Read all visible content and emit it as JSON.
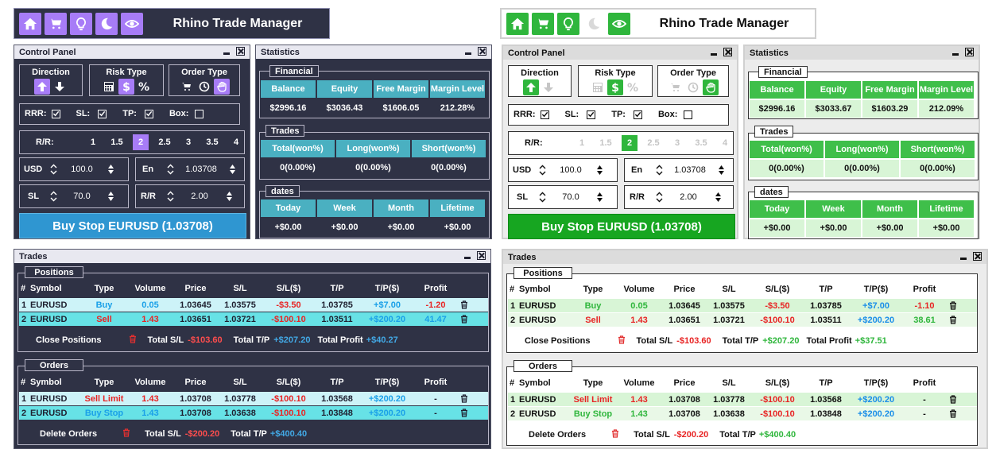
{
  "app_title": "Rhino Trade Manager",
  "window_titles": {
    "control_panel": "Control Panel",
    "statistics": "Statistics",
    "trades": "Trades"
  },
  "control": {
    "direction_label": "Direction",
    "risk_type_label": "Risk Type",
    "order_type_label": "Order Type",
    "rrr_label": "RRR:",
    "sl_label": "SL:",
    "tp_label": "TP:",
    "box_label": "Box:",
    "rr_label": "R/R:",
    "rr_options": [
      "1",
      "1.5",
      "2",
      "2.5",
      "3",
      "3.5",
      "4"
    ],
    "rr_selected": "2",
    "usd_label": "USD",
    "usd_value": "100.0",
    "en_label": "En",
    "en_value": "1.03708",
    "sl_field_label": "SL",
    "sl_value": "70.0",
    "rr_field_label": "R/R",
    "rr_value": "2.00",
    "buy_button": "Buy Stop EURUSD (1.03708)"
  },
  "stats": {
    "financial_title": "Financial",
    "financial_headers": [
      "Balance",
      "Equity",
      "Free Margin",
      "Margin Level"
    ],
    "trades_title": "Trades",
    "trades_headers": [
      "Total(won%)",
      "Long(won%)",
      "Short(won%)"
    ],
    "trades_values": [
      "0(0.00%)",
      "0(0.00%)",
      "0(0.00%)"
    ],
    "dates_title": "dates",
    "dates_headers": [
      "Today",
      "Week",
      "Month",
      "Lifetime"
    ],
    "dates_values": [
      "+$0.00",
      "+$0.00",
      "+$0.00",
      "+$0.00"
    ]
  },
  "positions": {
    "title": "Positions",
    "headers": [
      "#",
      "Symbol",
      "Type",
      "Volume",
      "Price",
      "S/L",
      "S/L($)",
      "T/P",
      "T/P($)",
      "Profit"
    ],
    "close_label": "Close Positions",
    "total_sl_label": "Total S/L",
    "total_sl": "-$103.60",
    "total_tp_label": "Total T/P",
    "total_tp": "+$207.20",
    "total_profit_label": "Total Profit"
  },
  "orders": {
    "title": "Orders",
    "headers": [
      "#",
      "Symbol",
      "Type",
      "Volume",
      "Price",
      "S/L",
      "S/L($)",
      "T/P",
      "T/P($)",
      "Profit"
    ],
    "rows": [
      [
        "1",
        "EURUSD",
        "Sell Limit",
        "1.43",
        "1.03708",
        "1.03778",
        "-$100.10",
        "1.03568",
        "+$200.20",
        "-"
      ],
      [
        "2",
        "EURUSD",
        "Buy Stop",
        "1.43",
        "1.03708",
        "1.03638",
        "-$100.10",
        "1.03848",
        "+$200.20",
        "-"
      ]
    ],
    "delete_label": "Delete Orders",
    "total_sl_label": "Total S/L",
    "total_sl": "-$200.20",
    "total_tp_label": "Total T/P",
    "total_tp": "+$400.40"
  },
  "dark": {
    "financial_values": [
      "$2996.16",
      "$3036.43",
      "$1606.05",
      "212.28%"
    ],
    "position_rows": [
      [
        "1",
        "EURUSD",
        "Buy",
        "0.05",
        "1.03645",
        "1.03575",
        "-$3.50",
        "1.03785",
        "+$7.00",
        "-1.20"
      ],
      [
        "2",
        "EURUSD",
        "Sell",
        "1.43",
        "1.03651",
        "1.03721",
        "-$100.10",
        "1.03511",
        "+$200.20",
        "41.47"
      ]
    ],
    "total_profit": "+$40.27",
    "colors": {
      "bg": "#2f3245",
      "accent": "#a77cf7",
      "header": "#4ab0c1",
      "button": "#2f96d1"
    }
  },
  "light": {
    "financial_values": [
      "$2996.16",
      "$3033.67",
      "$1603.29",
      "212.09%"
    ],
    "position_rows": [
      [
        "1",
        "EURUSD",
        "Buy",
        "0.05",
        "1.03645",
        "1.03575",
        "-$3.50",
        "1.03785",
        "+$7.00",
        "-1.10"
      ],
      [
        "2",
        "EURUSD",
        "Sell",
        "1.43",
        "1.03651",
        "1.03721",
        "-$100.10",
        "1.03511",
        "+$200.20",
        "38.61"
      ]
    ],
    "total_profit": "+$37.51",
    "colors": {
      "bg": "#ececec",
      "accent": "#2fb63c",
      "header": "#3fbf4a",
      "button": "#17a621"
    }
  },
  "icons": [
    "home-icon",
    "cart-icon",
    "bulb-icon",
    "moon-icon",
    "eye-icon",
    "arrow-up-icon",
    "arrow-down-icon",
    "calculator-icon",
    "dollar-icon",
    "percent-icon",
    "cart-order-icon",
    "clock-icon",
    "hand-icon",
    "checkbox-check-icon",
    "trash-icon",
    "stepper-up-icon",
    "stepper-down-icon",
    "minimize-icon",
    "close-icon"
  ]
}
